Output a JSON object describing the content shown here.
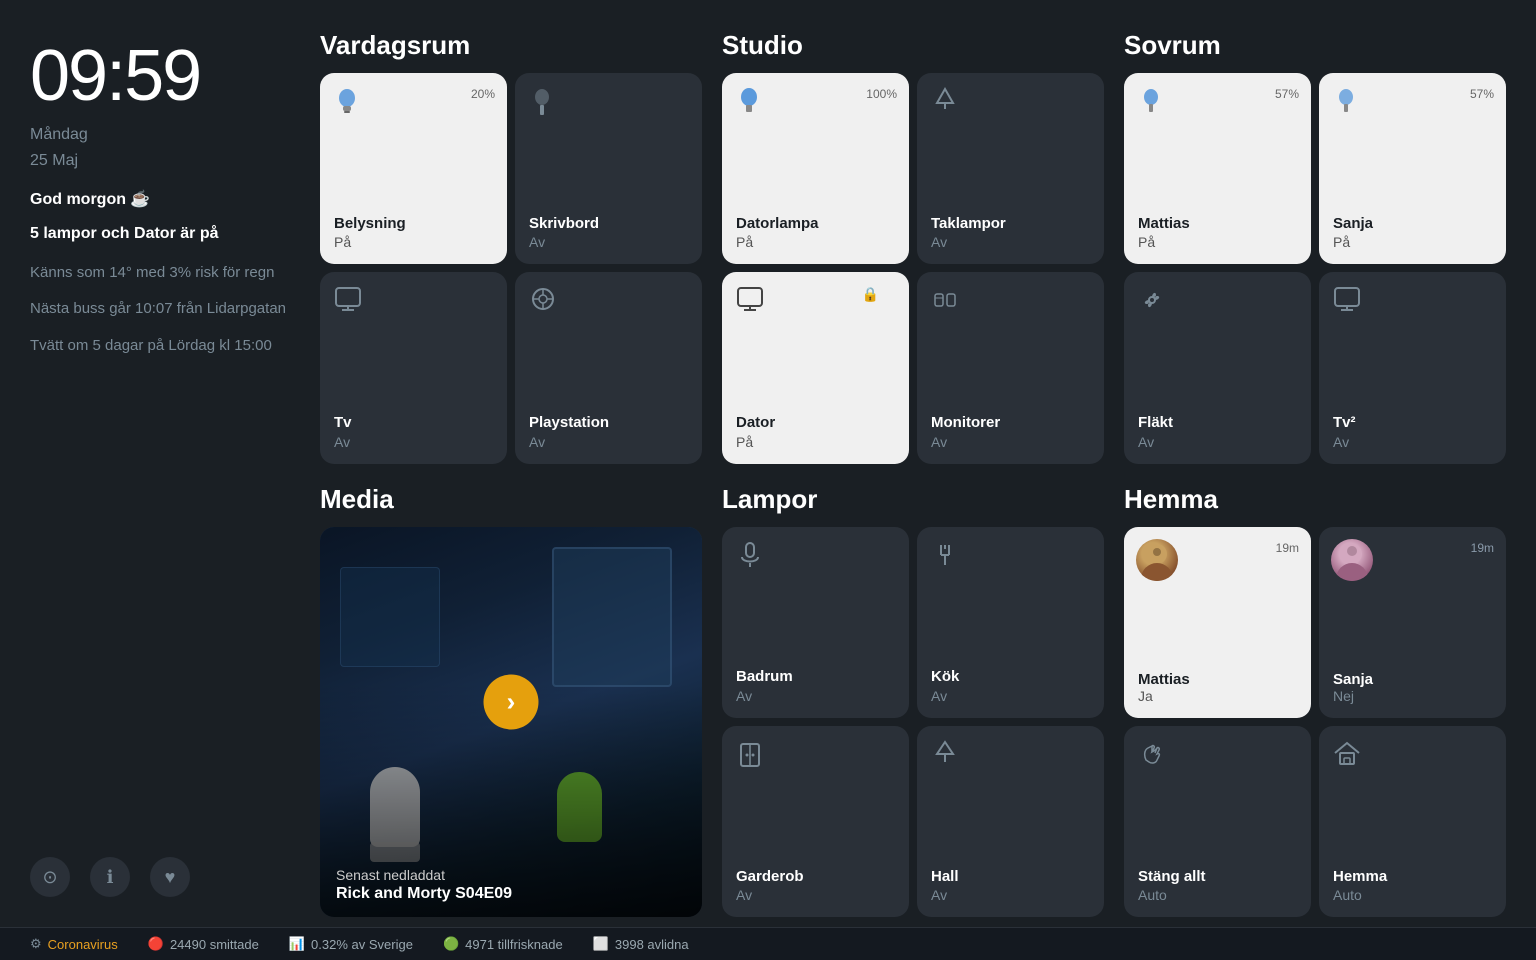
{
  "time": "09:59",
  "date": {
    "day": "Måndag",
    "date": "25 Maj"
  },
  "greeting": "God morgon ☕",
  "status_summary": "5 lampor och Dator är på",
  "weather": "Känns som 14° med 3% risk för regn",
  "bus": "Nästa buss går 10:07 från Lidarpgatan",
  "laundry": "Tvätt om 5 dagar på Lördag kl 15:00",
  "rooms": {
    "vardagsrum": {
      "title": "Vardagsrum",
      "tiles": [
        {
          "name": "Belysning",
          "status": "På",
          "active": true,
          "icon": "💡",
          "percent": "20%"
        },
        {
          "name": "Skrivbord",
          "status": "Av",
          "active": false,
          "icon": "🪔",
          "percent": ""
        },
        {
          "name": "Tv",
          "status": "Av",
          "active": false,
          "icon": "📺",
          "percent": ""
        },
        {
          "name": "Playstation",
          "status": "Av",
          "active": false,
          "icon": "🎮",
          "percent": ""
        }
      ]
    },
    "studio": {
      "title": "Studio",
      "tiles": [
        {
          "name": "Datorlampa",
          "status": "På",
          "active": true,
          "icon": "💡",
          "percent": "100%"
        },
        {
          "name": "Taklampor",
          "status": "Av",
          "active": false,
          "icon": "🔷",
          "percent": ""
        },
        {
          "name": "Dator",
          "status": "På",
          "active": true,
          "icon": "🖥️",
          "percent": "",
          "locked": true
        },
        {
          "name": "Monitorer",
          "status": "Av",
          "active": false,
          "icon": "📡",
          "percent": ""
        }
      ]
    },
    "sovrum": {
      "title": "Sovrum",
      "tiles": [
        {
          "name": "Mattias",
          "status": "På",
          "active": true,
          "icon": "💡",
          "percent": "57%"
        },
        {
          "name": "Sanja",
          "status": "På",
          "active": true,
          "icon": "💡",
          "percent": "57%"
        },
        {
          "name": "Fläkt",
          "status": "Av",
          "active": false,
          "icon": "🌀",
          "percent": ""
        },
        {
          "name": "Tv²",
          "status": "Av",
          "active": false,
          "icon": "📺",
          "percent": ""
        }
      ]
    }
  },
  "media": {
    "title": "Media",
    "label": "Senast nedladdat",
    "show": "Rick and Morty S04E09"
  },
  "lampor": {
    "title": "Lampor",
    "tiles": [
      {
        "name": "Badrum",
        "status": "Av",
        "icon": "🚿"
      },
      {
        "name": "Kök",
        "status": "Av",
        "icon": "🍴"
      },
      {
        "name": "Garderob",
        "status": "Av",
        "icon": "🚪"
      },
      {
        "name": "Hall",
        "status": "Av",
        "icon": "💧"
      }
    ]
  },
  "hemma": {
    "title": "Hemma",
    "people": [
      {
        "name": "Mattias",
        "status": "Ja",
        "time": "19m",
        "active": true
      },
      {
        "name": "Sanja",
        "status": "Nej",
        "time": "19m",
        "active": false
      }
    ],
    "actions": [
      {
        "name": "Stäng allt",
        "status": "Auto",
        "icon": "👋"
      },
      {
        "name": "Hemma",
        "status": "Auto",
        "icon": "🏠"
      }
    ]
  },
  "statusbar": {
    "virus_label": "Coronavirus",
    "infected": "24490 smittade",
    "percent": "0.32% av Sverige",
    "recovered": "4971 tillfrisknade",
    "deceased": "3998 avlidna"
  },
  "bottom_icons": [
    "⊙",
    "ℹ",
    "♥"
  ]
}
